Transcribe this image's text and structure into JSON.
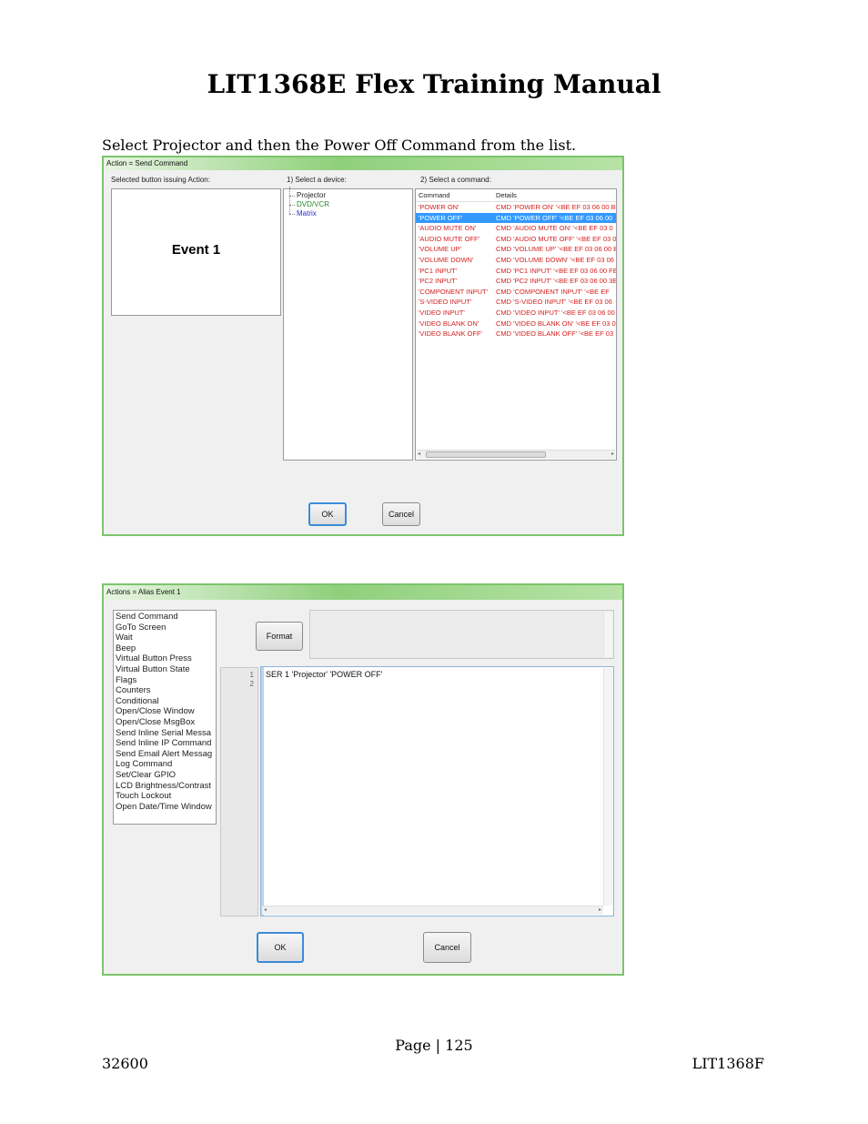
{
  "document": {
    "title": "LIT1368E Flex Training Manual",
    "instruction": "Select Projector and then the Power Off Command from the list.",
    "page_label": "Page | 125",
    "footer_left": "32600",
    "footer_right": "LIT1368F"
  },
  "dialog_send_command": {
    "title": "Action = Send Command",
    "selected_label": "Selected button issuing Action:",
    "device_label": "1) Select a device:",
    "command_label": "2) Select a command:",
    "selected_button": "Event 1",
    "devices": [
      "Projector",
      "DVD/VCR",
      "Matrix"
    ],
    "command_header": "Command",
    "details_header": "Details",
    "commands": [
      {
        "command": "'POWER ON'",
        "details": "CMD 'POWER ON' '<BE EF 03 06 00 B"
      },
      {
        "command": "'POWER OFF'",
        "details": "CMD 'POWER OFF' '<BE EF 03 06 00",
        "selected": true
      },
      {
        "command": "'AUDIO MUTE ON'",
        "details": "CMD 'AUDIO MUTE ON' '<BE EF 03 0"
      },
      {
        "command": "'AUDIO MUTE OFF'",
        "details": "CMD 'AUDIO MUTE OFF' '<BE EF 03 0"
      },
      {
        "command": "'VOLUME UP'",
        "details": "CMD 'VOLUME UP' '<BE EF 03 06 00 B"
      },
      {
        "command": "'VOLUME DOWN'",
        "details": "CMD 'VOLUME DOWN' '<BE EF 03 06"
      },
      {
        "command": "'PC1 INPUT'",
        "details": "CMD 'PC1 INPUT' '<BE EF 03 06 00 FE"
      },
      {
        "command": "'PC2 INPUT'",
        "details": "CMD 'PC2 INPUT' '<BE EF 03 06 00 3E"
      },
      {
        "command": "'COMPONENT INPUT'",
        "details": "CMD 'COMPONENT INPUT' '<BE EF"
      },
      {
        "command": "'S-VIDEO INPUT'",
        "details": "CMD 'S-VIDEO INPUT' '<BE EF 03 06"
      },
      {
        "command": "'VIDEO INPUT'",
        "details": "CMD 'VIDEO INPUT' '<BE EF 03 06 00"
      },
      {
        "command": "'VIDEO BLANK ON'",
        "details": "CMD 'VIDEO BLANK ON' '<BE EF 03 0"
      },
      {
        "command": "'VIDEO BLANK OFF'",
        "details": "CMD 'VIDEO BLANK OFF' '<BE EF 03"
      }
    ],
    "ok_label": "OK",
    "cancel_label": "Cancel"
  },
  "dialog_alias": {
    "title": "Actions = Alias Event 1",
    "actions": [
      "Send Command",
      "GoTo Screen",
      "Wait",
      "Beep",
      "Virtual Button Press",
      "Virtual Button State",
      "Flags",
      "Counters",
      "Conditional",
      "Open/Close Window",
      "Open/Close MsgBox",
      "Send Inline Serial Messa",
      "Send Inline IP Command",
      "Send Email Alert Messag",
      "Log Command",
      "Set/Clear GPIO",
      "LCD Brightness/Contrast",
      "Touch Lockout",
      "Open Date/Time Window"
    ],
    "format_label": "Format",
    "line_numbers": [
      "1",
      "2"
    ],
    "code_line": "SER 1 'Projector' 'POWER OFF'",
    "ok_label": "OK",
    "cancel_label": "Cancel"
  }
}
